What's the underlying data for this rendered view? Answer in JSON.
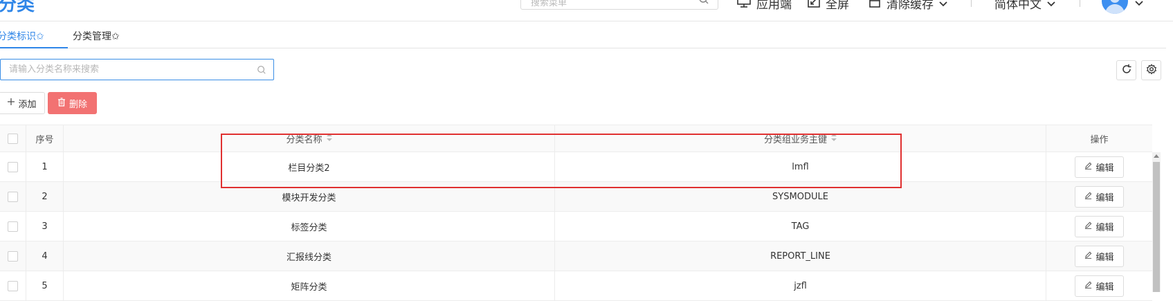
{
  "header": {
    "title": "分类",
    "search_placeholder": "搜索菜单",
    "items": {
      "app_label": "应用端",
      "fullscreen_label": "全屏",
      "clear_cache_label": "清除缓存",
      "language_label": "简体中文"
    }
  },
  "tabs": [
    {
      "label": "分类标识✩",
      "active": true
    },
    {
      "label": "分类管理✩",
      "active": false
    }
  ],
  "search": {
    "placeholder": "请输入分类名称来搜索"
  },
  "actions": {
    "add_label": "添加",
    "delete_label": "删除"
  },
  "table": {
    "columns": {
      "index": "序号",
      "name": "分类名称",
      "key": "分类组业务主键",
      "op": "操作"
    },
    "edit_label": "编辑",
    "rows": [
      {
        "index": "1",
        "name": "栏目分类2",
        "key": "lmfl"
      },
      {
        "index": "2",
        "name": "模块开发分类",
        "key": "SYSMODULE"
      },
      {
        "index": "3",
        "name": "标签分类",
        "key": "TAG"
      },
      {
        "index": "4",
        "name": "汇报线分类",
        "key": "REPORT_LINE"
      },
      {
        "index": "5",
        "name": "矩阵分类",
        "key": "jzfl"
      }
    ]
  },
  "colors": {
    "primary": "#2f86e8",
    "danger": "#f27272",
    "highlight": "#e03030"
  }
}
